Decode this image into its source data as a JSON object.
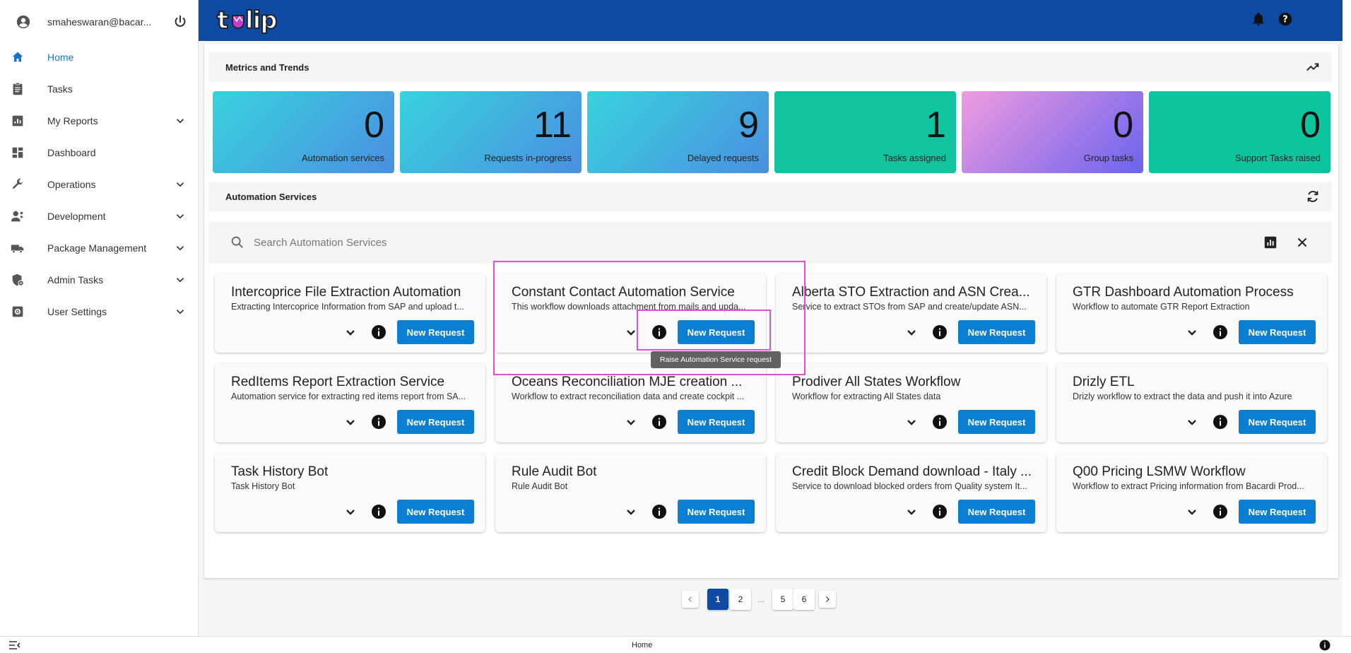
{
  "user": {
    "email": "smaheswaran@bacar..."
  },
  "sidebar": {
    "items": [
      {
        "label": "Home",
        "icon": "home-icon",
        "active": true,
        "expandable": false
      },
      {
        "label": "Tasks",
        "icon": "clipboard-icon",
        "active": false,
        "expandable": false
      },
      {
        "label": "My Reports",
        "icon": "report-icon",
        "active": false,
        "expandable": true
      },
      {
        "label": "Dashboard",
        "icon": "dashboard-icon",
        "active": false,
        "expandable": false
      },
      {
        "label": "Operations",
        "icon": "wrench-icon",
        "active": false,
        "expandable": true
      },
      {
        "label": "Development",
        "icon": "developer-icon",
        "active": false,
        "expandable": true
      },
      {
        "label": "Package Management",
        "icon": "truck-icon",
        "active": false,
        "expandable": true
      },
      {
        "label": "Admin Tasks",
        "icon": "admin-icon",
        "active": false,
        "expandable": true
      },
      {
        "label": "User Settings",
        "icon": "settings-icon",
        "active": false,
        "expandable": true
      }
    ]
  },
  "header": {
    "logo": "tulip"
  },
  "metrics_section": {
    "title": "Metrics and Trends"
  },
  "metrics": [
    {
      "value": "0",
      "label": "Automation services",
      "colors": [
        "#38d3de",
        "#4a8fe0"
      ]
    },
    {
      "value": "11",
      "label": "Requests in-progress",
      "colors": [
        "#38d3de",
        "#4a8fe0"
      ]
    },
    {
      "value": "9",
      "label": "Delayed requests",
      "colors": [
        "#38d3de",
        "#4a8fe0"
      ]
    },
    {
      "value": "1",
      "label": "Tasks assigned",
      "colors": [
        "#10c4a0",
        "#10c4a0"
      ]
    },
    {
      "value": "0",
      "label": "Group tasks",
      "colors": [
        "#f09be0",
        "#6a63ee"
      ]
    },
    {
      "value": "0",
      "label": "Support Tasks raised",
      "colors": [
        "#0cc49e",
        "#0cc49e"
      ]
    }
  ],
  "services_section": {
    "title": "Automation Services"
  },
  "search": {
    "placeholder": "Search Automation Services",
    "value": ""
  },
  "cards": [
    {
      "title": "Intercoprice File Extraction Automation",
      "desc": "Extracting Intercoprice Information from SAP and upload t..."
    },
    {
      "title": "Constant Contact Automation Service",
      "desc": "This workflow downloads attachment from mails and upda..."
    },
    {
      "title": "Alberta STO Extraction and ASN Crea...",
      "desc": "Service to extract STOs from SAP and create/update ASN..."
    },
    {
      "title": "GTR Dashboard Automation Process",
      "desc": "Workflow to automate GTR Report Extraction"
    },
    {
      "title": "RedItems Report Extraction Service",
      "desc": "Automation service for extracting red items report from SA..."
    },
    {
      "title": "Oceans Reconciliation MJE creation ...",
      "desc": "Workflow to extract reconciliation data and create cockpit ..."
    },
    {
      "title": "Prodiver All States Workflow",
      "desc": "Workflow for extracting All States data"
    },
    {
      "title": "Drizly ETL",
      "desc": "Drizly workflow to extract the data and push it into Azure"
    },
    {
      "title": "Task History Bot",
      "desc": "Task History Bot"
    },
    {
      "title": "Rule Audit Bot",
      "desc": "Rule Audit Bot"
    },
    {
      "title": "Credit Block Demand download - Italy ...",
      "desc": "Service to download blocked orders from Quality system It..."
    },
    {
      "title": "Q00 Pricing LSMW Workflow",
      "desc": "Workflow to extract Pricing information from Bacardi Prod..."
    }
  ],
  "card_button_label": "New Request",
  "tooltip": "Raise Automation Service request",
  "pagination": {
    "pages": [
      "1",
      "2",
      "...",
      "5",
      "6"
    ],
    "current": "1"
  },
  "footer": {
    "breadcrumb": "Home"
  }
}
